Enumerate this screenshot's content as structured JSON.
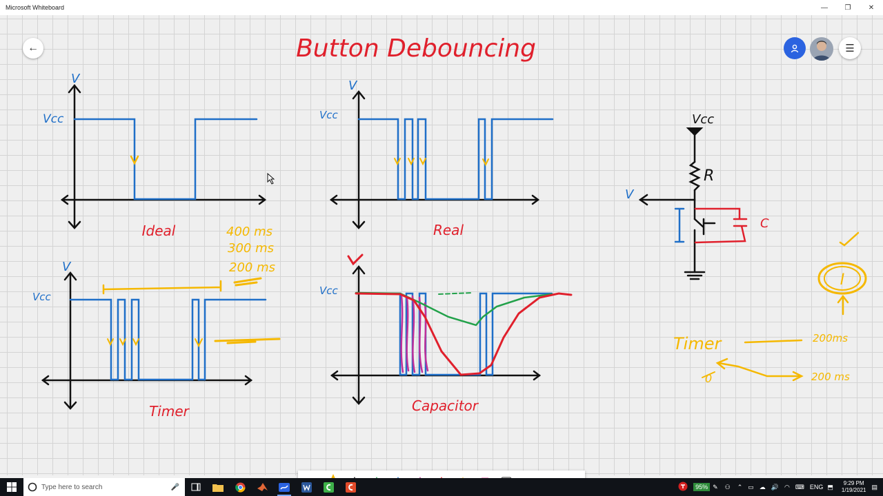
{
  "window": {
    "title": "Microsoft Whiteboard",
    "controls": [
      "—",
      "❐",
      "✕"
    ]
  },
  "board": {
    "title": "Button Debouncing",
    "diagrams": {
      "ideal": {
        "caption": "Ideal",
        "y_label": "V",
        "vcc_label": "Vcc"
      },
      "real": {
        "caption": "Real",
        "y_label": "V",
        "vcc_label": "Vcc"
      },
      "timer": {
        "caption": "Timer",
        "y_label": "V",
        "vcc_label": "Vcc",
        "notes": [
          "400 ms",
          "300 ms",
          "200 ms"
        ]
      },
      "capacitor": {
        "caption": "Capacitor",
        "y_label": "V",
        "vcc_label": "Vcc"
      },
      "circuit": {
        "vcc_label": "Vcc",
        "resistor_label": "R",
        "capacitor_label": "C",
        "out_label": "V"
      },
      "notes": {
        "timer_label": "Timer",
        "timer_value": "200ms",
        "bottom_value": "200 ms",
        "zero_label": "0",
        "interrupt_label": "I"
      }
    }
  },
  "toolbar": {
    "tools": [
      "select-tool",
      "pen-yellow",
      "pen-black",
      "pen-green",
      "pen-blue",
      "pen-magenta",
      "pen-red",
      "highlighter-yellow",
      "highlighter-pink",
      "eraser",
      "lasso",
      "undo",
      "redo"
    ]
  },
  "taskbar": {
    "search_placeholder": "Type here to search",
    "battery": "95%",
    "language": "ENG",
    "time": "9:29 PM",
    "date": "1/19/2021"
  },
  "colors": {
    "ink_blue": "#1f6fc8",
    "ink_red": "#e0202c",
    "ink_orange": "#f5b800",
    "ink_green": "#22a14a",
    "ink_magenta": "#c0309a",
    "accent": "#2b63e0"
  }
}
